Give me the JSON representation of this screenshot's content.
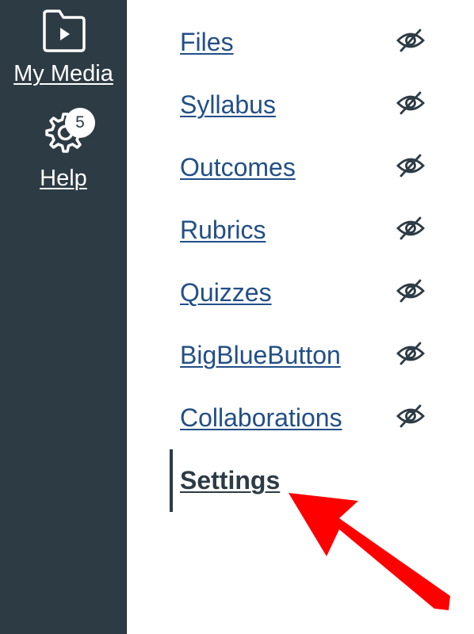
{
  "global_nav": {
    "my_media": {
      "label": "My Media",
      "icon": "media-folder-icon"
    },
    "help": {
      "label": "Help",
      "icon": "help-gear-icon",
      "badge": "5"
    }
  },
  "course_nav": {
    "items": [
      {
        "label": "Files",
        "hidden": true
      },
      {
        "label": "Syllabus",
        "hidden": true
      },
      {
        "label": "Outcomes",
        "hidden": true
      },
      {
        "label": "Rubrics",
        "hidden": true
      },
      {
        "label": "Quizzes",
        "hidden": true
      },
      {
        "label": "BigBlueButton",
        "hidden": true
      },
      {
        "label": "Collaborations",
        "hidden": true
      },
      {
        "label": "Settings",
        "hidden": false,
        "active": true
      }
    ]
  },
  "annotation": {
    "type": "arrow",
    "color": "#ff0000",
    "points_to": "Settings"
  },
  "colors": {
    "sidebar": "#2d3b45",
    "link": "#224f87",
    "active": "#2d3b45",
    "annotation": "#ff0000"
  }
}
